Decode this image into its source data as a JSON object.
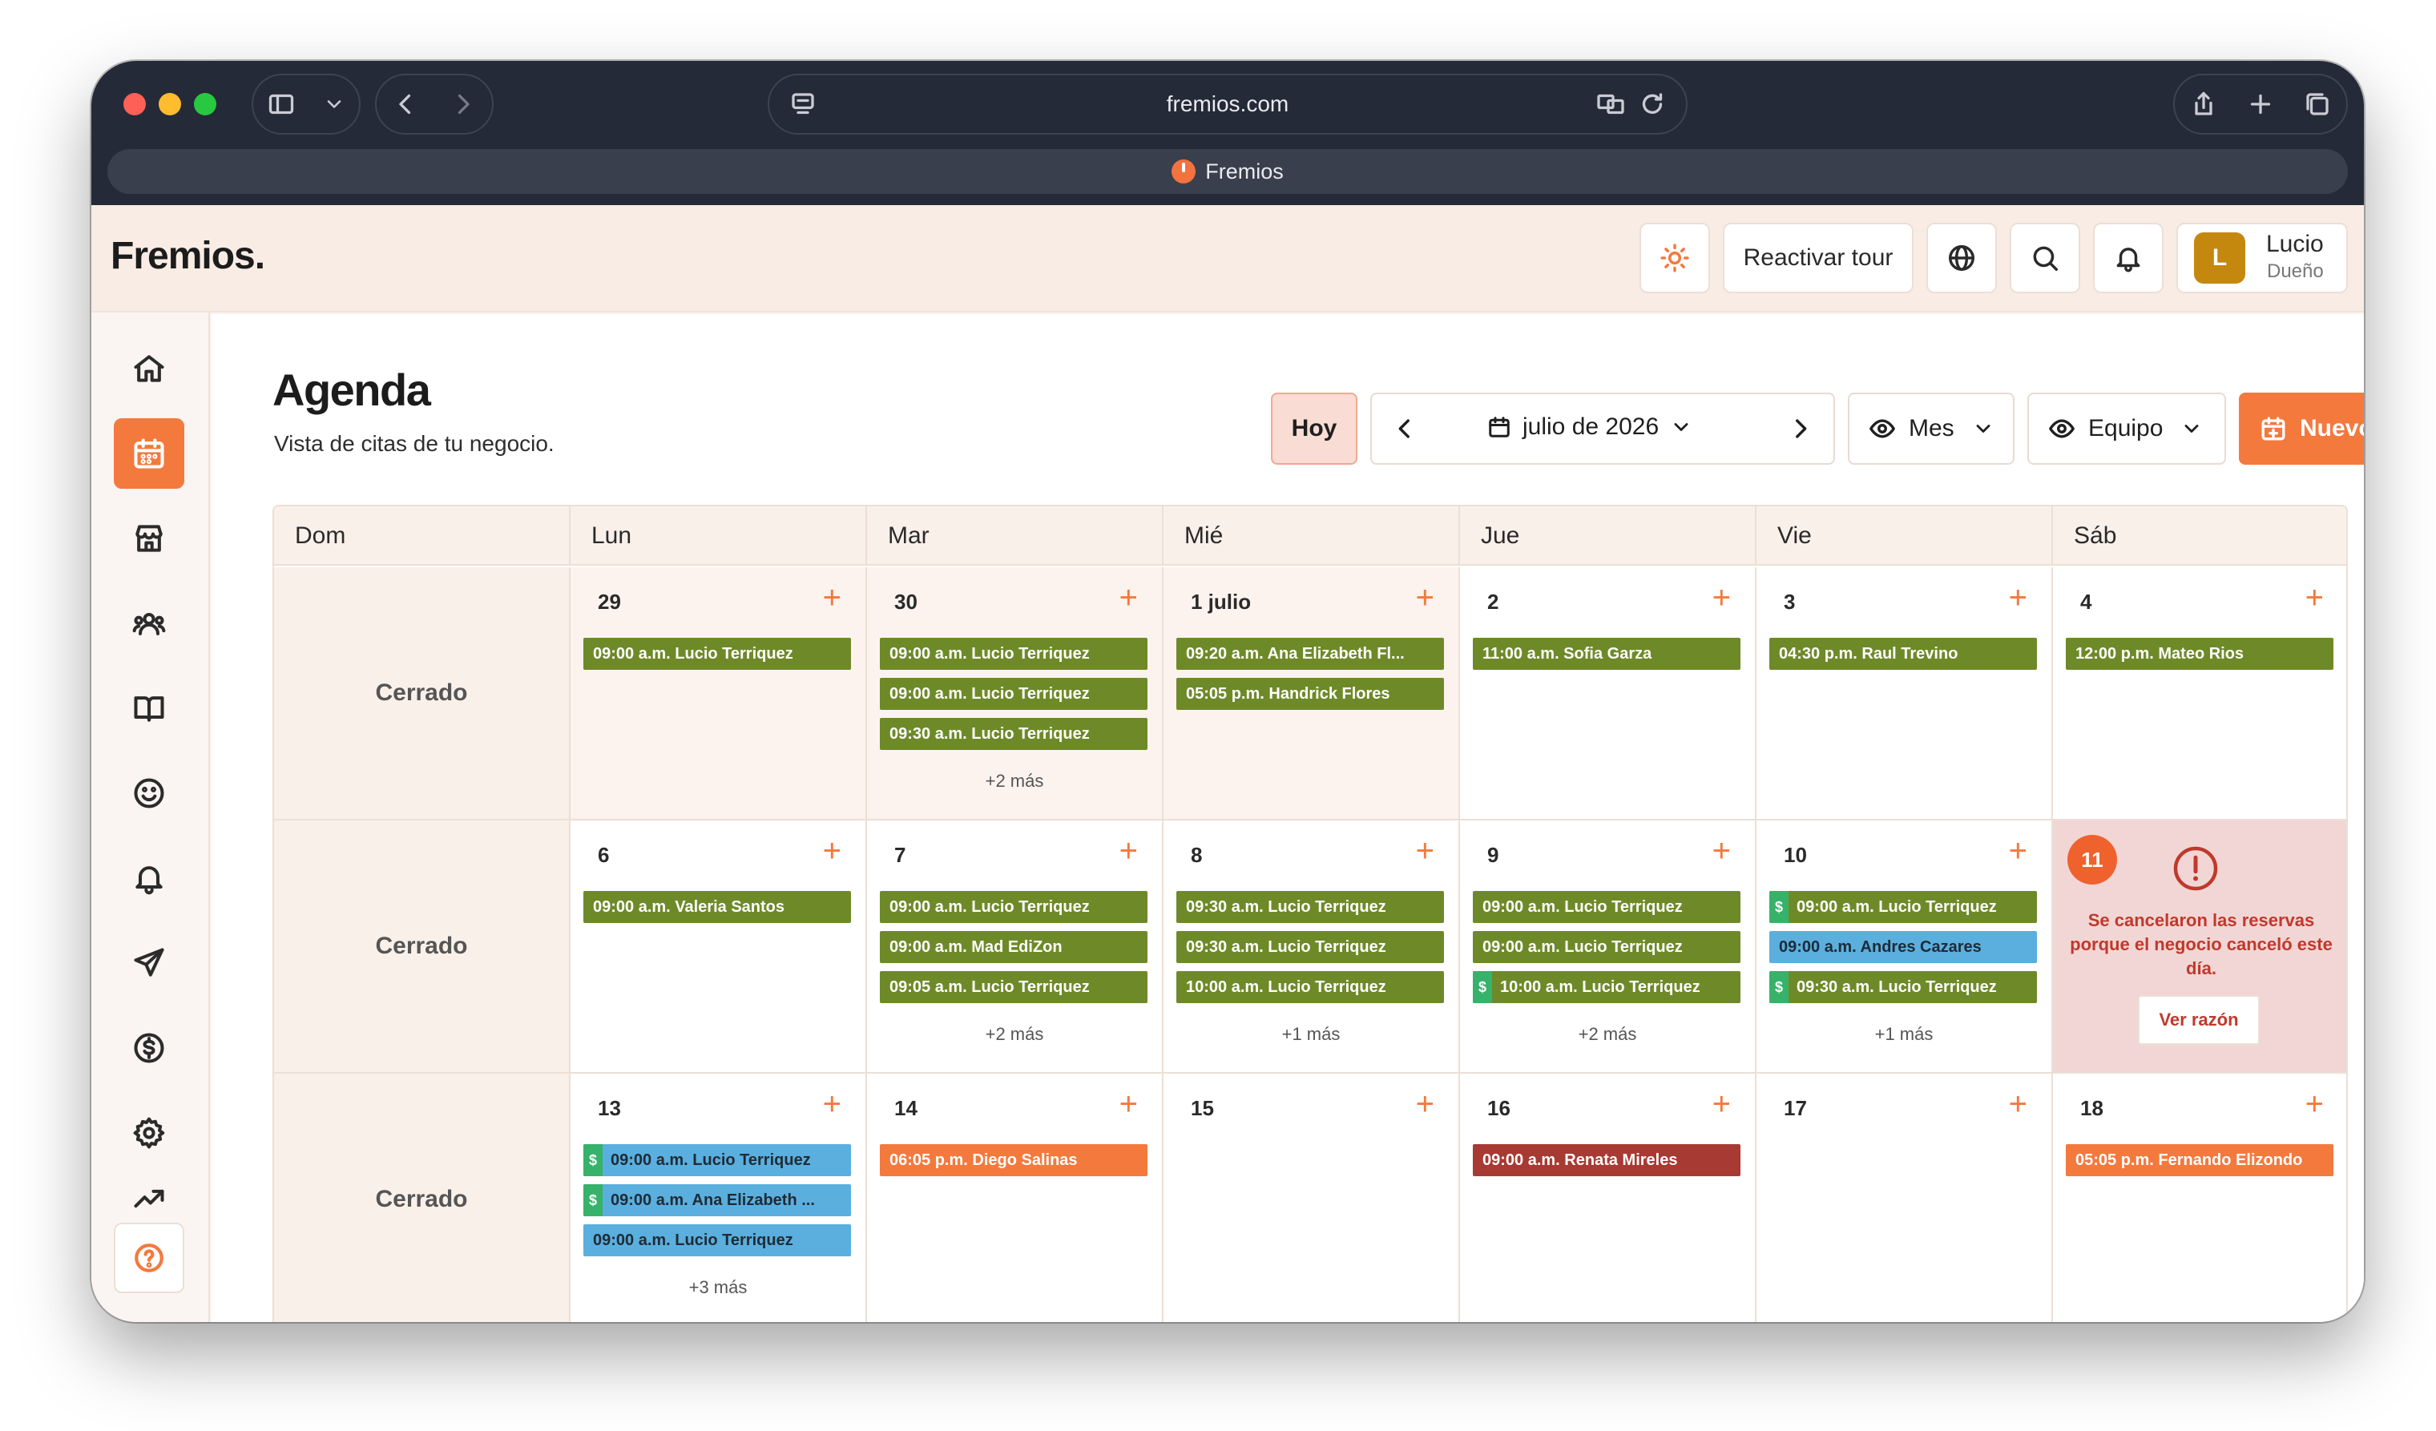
{
  "browser": {
    "url": "fremios.com",
    "tab_title": "Fremios"
  },
  "header": {
    "brand": "Fremios.",
    "tour_label": "Reactivar tour",
    "user_name": "Lucio",
    "user_role": "Dueño",
    "user_initial": "L"
  },
  "page": {
    "title": "Agenda",
    "subtitle": "Vista de citas de tu negocio."
  },
  "controls": {
    "today": "Hoy",
    "month_label": "julio de 2026",
    "view": "Mes",
    "team": "Equipo",
    "new": "Nuevo"
  },
  "calendar": {
    "weekdays": [
      "Dom",
      "Lun",
      "Mar",
      "Mié",
      "Jue",
      "Vie",
      "Sáb"
    ],
    "closed_label": "Cerrado",
    "weeks": [
      {
        "days": [
          {
            "closed": true
          },
          {
            "num": "29",
            "past": true,
            "events": [
              {
                "t": "09:00 a.m. Lucio Terriquez",
                "c": "g"
              }
            ]
          },
          {
            "num": "30",
            "past": true,
            "events": [
              {
                "t": "09:00 a.m. Lucio Terriquez",
                "c": "g"
              },
              {
                "t": "09:00 a.m. Lucio Terriquez",
                "c": "g"
              },
              {
                "t": "09:30 a.m. Lucio Terriquez",
                "c": "g"
              }
            ],
            "more": "+2 más"
          },
          {
            "num": "1 julio",
            "past": true,
            "events": [
              {
                "t": "09:20 a.m. Ana Elizabeth Fl...",
                "c": "g"
              },
              {
                "t": "05:05 p.m. Handrick Flores",
                "c": "g"
              }
            ]
          },
          {
            "num": "2",
            "events": [
              {
                "t": "11:00 a.m. Sofia Garza",
                "c": "g"
              }
            ]
          },
          {
            "num": "3",
            "events": [
              {
                "t": "04:30 p.m. Raul Trevino",
                "c": "g"
              }
            ]
          },
          {
            "num": "4",
            "events": [
              {
                "t": "12:00 p.m. Mateo Rios",
                "c": "g"
              }
            ]
          }
        ]
      },
      {
        "days": [
          {
            "closed": true
          },
          {
            "num": "6",
            "events": [
              {
                "t": "09:00 a.m. Valeria Santos",
                "c": "g"
              }
            ]
          },
          {
            "num": "7",
            "events": [
              {
                "t": "09:00 a.m. Lucio Terriquez",
                "c": "g"
              },
              {
                "t": "09:00 a.m. Mad EdiZon",
                "c": "g"
              },
              {
                "t": "09:05 a.m. Lucio Terriquez",
                "c": "g"
              }
            ],
            "more": "+2 más"
          },
          {
            "num": "8",
            "events": [
              {
                "t": "09:30 a.m. Lucio Terriquez",
                "c": "g"
              },
              {
                "t": "09:30 a.m. Lucio Terriquez",
                "c": "g"
              },
              {
                "t": "10:00 a.m. Lucio Terriquez",
                "c": "g"
              }
            ],
            "more": "+1 más"
          },
          {
            "num": "9",
            "events": [
              {
                "t": "09:00 a.m. Lucio Terriquez",
                "c": "g"
              },
              {
                "t": "09:00 a.m. Lucio Terriquez",
                "c": "g"
              },
              {
                "t": "10:00 a.m. Lucio Terriquez",
                "c": "g",
                "paid": true
              }
            ],
            "more": "+2 más"
          },
          {
            "num": "10",
            "events": [
              {
                "t": "09:00 a.m. Lucio Terriquez",
                "c": "g",
                "paid": true
              },
              {
                "t": "09:00 a.m. Andres Cazares",
                "c": "b"
              },
              {
                "t": "09:30 a.m. Lucio Terriquez",
                "c": "g",
                "paid": true
              }
            ],
            "more": "+1 más"
          },
          {
            "num": "11",
            "cancelled": true,
            "cancel_msg": "Se cancelaron las reservas porque el negocio canceló este día.",
            "reason_btn": "Ver razón"
          }
        ]
      },
      {
        "days": [
          {
            "closed": true
          },
          {
            "num": "13",
            "events": [
              {
                "t": "09:00 a.m. Lucio Terriquez",
                "c": "b",
                "paid": true
              },
              {
                "t": "09:00 a.m. Ana Elizabeth ...",
                "c": "b",
                "paid": true
              },
              {
                "t": "09:00 a.m. Lucio Terriquez",
                "c": "b"
              }
            ],
            "more": "+3 más"
          },
          {
            "num": "14",
            "events": [
              {
                "t": "06:05 p.m. Diego Salinas",
                "c": "o"
              }
            ]
          },
          {
            "num": "15",
            "events": []
          },
          {
            "num": "16",
            "events": [
              {
                "t": "09:00 a.m. Renata Mireles",
                "c": "r"
              }
            ]
          },
          {
            "num": "17",
            "events": []
          },
          {
            "num": "18",
            "events": [
              {
                "t": "05:05 p.m. Fernando Elizondo",
                "c": "o"
              }
            ]
          }
        ]
      }
    ]
  },
  "colors": {
    "accent": "#f4793d",
    "event_green": "#6e8a28",
    "event_blue": "#5aafde",
    "event_red": "#a73a33",
    "paid_badge": "#36b26a"
  }
}
